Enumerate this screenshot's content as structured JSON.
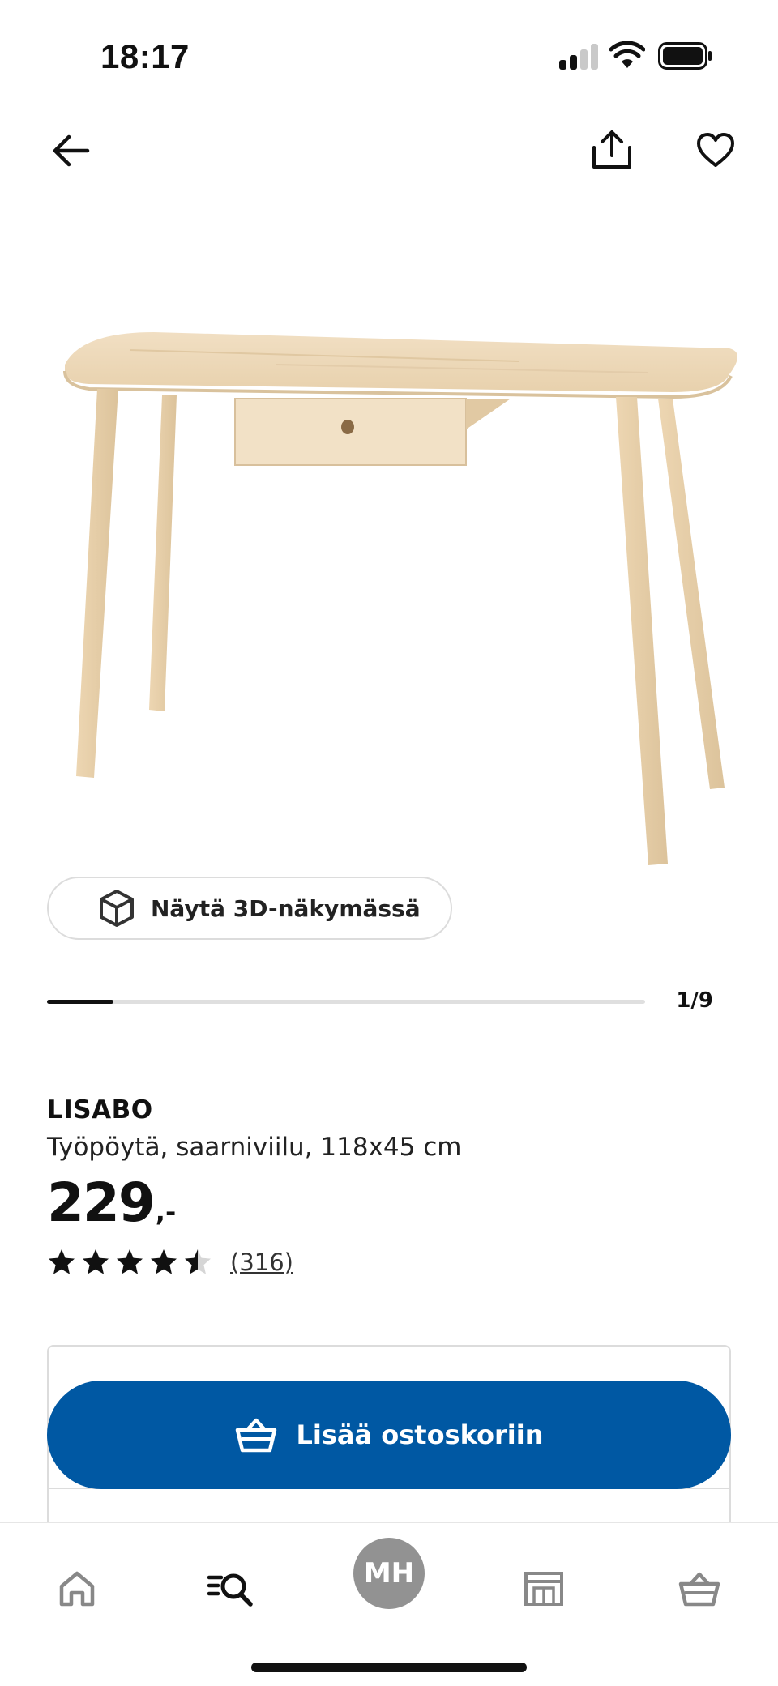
{
  "status_bar": {
    "time": "18:17"
  },
  "nav": {
    "back_icon": "arrow-left-icon",
    "share_icon": "share-icon",
    "favorite_icon": "heart-icon"
  },
  "product": {
    "image": "desk-product-image",
    "name": "LISABO",
    "description": "Työpöytä, saarniviilu, 118x45 cm",
    "price_integer": "229",
    "price_suffix": ",-",
    "rating": 4.5,
    "rating_max": 5,
    "review_count": "(316)"
  },
  "view3d": {
    "label": "Näytä 3D-näkymässä",
    "icon": "cube-icon"
  },
  "gallery": {
    "counter": "1/9",
    "current": 1,
    "total": 9
  },
  "buy": {
    "add_to_cart_label": "Lisää ostoskoriin",
    "icon": "basket-icon"
  },
  "bottom_nav": {
    "tabs": [
      "home-icon",
      "search-list-icon",
      "avatar",
      "store-icon",
      "basket-icon"
    ],
    "avatar_initials": "MH"
  },
  "colors": {
    "accent": "#0058a3",
    "avatar_bg": "#929292",
    "wood": "#f0dcbd"
  }
}
